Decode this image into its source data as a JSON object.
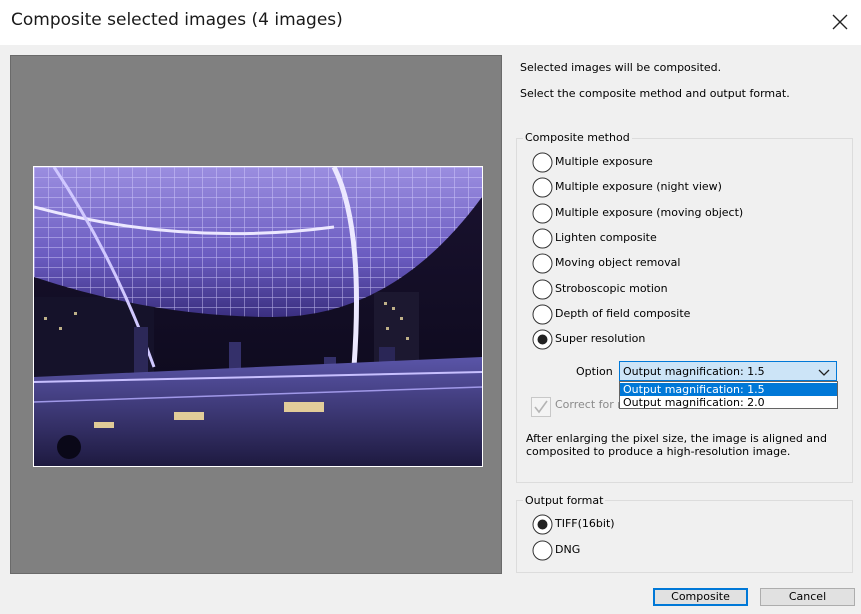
{
  "window": {
    "title": "Composite selected images (4 images)"
  },
  "info": {
    "line1": "Selected images will be composited.",
    "line2": "Select the composite method and output format."
  },
  "composite_method": {
    "legend": "Composite method",
    "options": [
      {
        "label": "Multiple exposure",
        "selected": false
      },
      {
        "label": "Multiple exposure (night view)",
        "selected": false
      },
      {
        "label": "Multiple exposure (moving object)",
        "selected": false
      },
      {
        "label": "Lighten composite",
        "selected": false
      },
      {
        "label": "Moving object removal",
        "selected": false
      },
      {
        "label": "Stroboscopic motion",
        "selected": false
      },
      {
        "label": "Depth of field composite",
        "selected": false
      },
      {
        "label": "Super resolution",
        "selected": true
      }
    ],
    "option_label": "Option",
    "option_value": "Output magnification: 1.5",
    "dropdown_items": [
      "Output magnification: 1.5",
      "Output magnification: 2.0"
    ],
    "correct_label_visible": "Correct for m",
    "correct_checked": true,
    "description": [
      "After enlarging the pixel size, the image is aligned and",
      "composited to produce a high-resolution image."
    ]
  },
  "output_format": {
    "legend": "Output format",
    "options": [
      {
        "label": "TIFF(16bit)",
        "selected": true
      },
      {
        "label": "DNG",
        "selected": false
      }
    ]
  },
  "buttons": {
    "composite": "Composite",
    "cancel": "Cancel"
  },
  "colors": {
    "accent": "#0078d7",
    "selection_bg": "#cce4f7",
    "preview_bg": "#808080"
  }
}
